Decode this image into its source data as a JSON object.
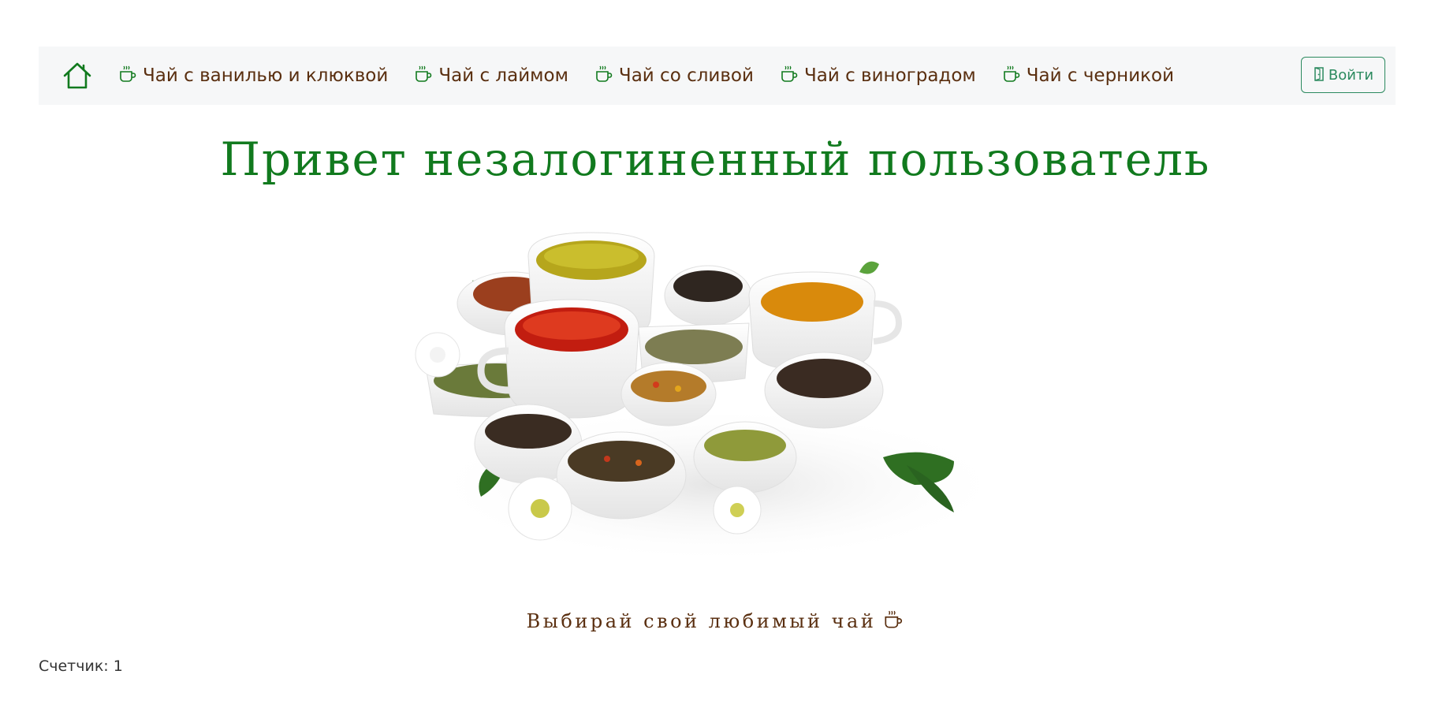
{
  "colors": {
    "accent_green": "#117a1e",
    "nav_text_brown": "#5a2f10",
    "login_teal": "#2c8a5f",
    "navbar_bg": "#f6f7f8"
  },
  "navbar": {
    "home_icon": "home-icon",
    "items": [
      {
        "label": "Чай с ванилью и клюквой",
        "icon": "tea-cup-icon"
      },
      {
        "label": "Чай с лаймом",
        "icon": "tea-cup-icon"
      },
      {
        "label": "Чай со сливой",
        "icon": "tea-cup-icon"
      },
      {
        "label": "Чай с виноградом",
        "icon": "tea-cup-icon"
      },
      {
        "label": "Чай с черникой",
        "icon": "tea-cup-icon"
      }
    ],
    "login": {
      "label": "Войти",
      "icon": "door-icon"
    }
  },
  "main": {
    "title": "Привет незалогиненный пользователь",
    "hero_image": "tea-assortment-image",
    "tagline": "Выбирай свой любимый чай",
    "tagline_icon": "tea-cup-icon"
  },
  "footer": {
    "counter": "Счетчик: 1"
  }
}
